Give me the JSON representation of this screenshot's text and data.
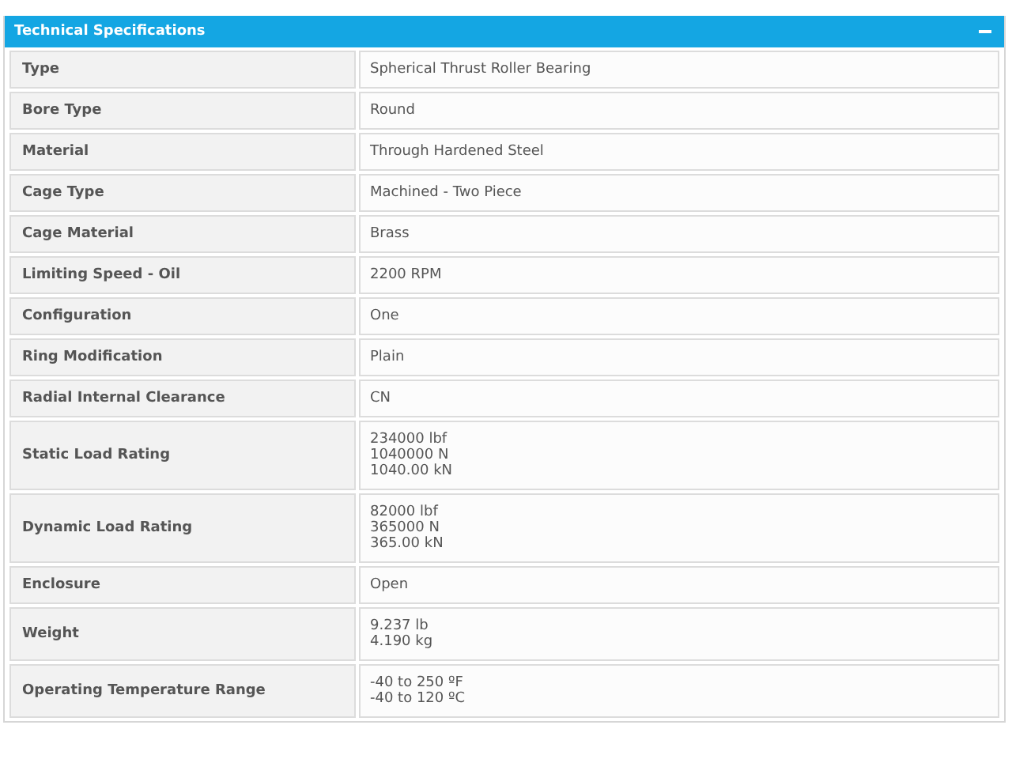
{
  "panel": {
    "title": "Technical Specifications",
    "expanded": true
  },
  "specs": [
    {
      "label": "Type",
      "value": "Spherical Thrust Roller Bearing"
    },
    {
      "label": "Bore Type",
      "value": "Round"
    },
    {
      "label": "Material",
      "value": "Through Hardened Steel"
    },
    {
      "label": "Cage Type",
      "value": "Machined - Two Piece"
    },
    {
      "label": "Cage Material",
      "value": "Brass"
    },
    {
      "label": "Limiting Speed - Oil",
      "value": "2200 RPM"
    },
    {
      "label": "Configuration",
      "value": "One"
    },
    {
      "label": "Ring Modification",
      "value": "Plain"
    },
    {
      "label": "Radial Internal Clearance",
      "value": "CN"
    },
    {
      "label": "Static Load Rating",
      "value": "234000 lbf\n1040000 N\n1040.00 kN"
    },
    {
      "label": "Dynamic Load Rating",
      "value": "82000 lbf\n365000 N\n365.00 kN"
    },
    {
      "label": "Enclosure",
      "value": "Open"
    },
    {
      "label": "Weight",
      "value": "9.237 lb\n4.190 kg"
    },
    {
      "label": "Operating Temperature Range",
      "value": "-40 to 250 ºF\n-40 to 120 ºC"
    }
  ]
}
